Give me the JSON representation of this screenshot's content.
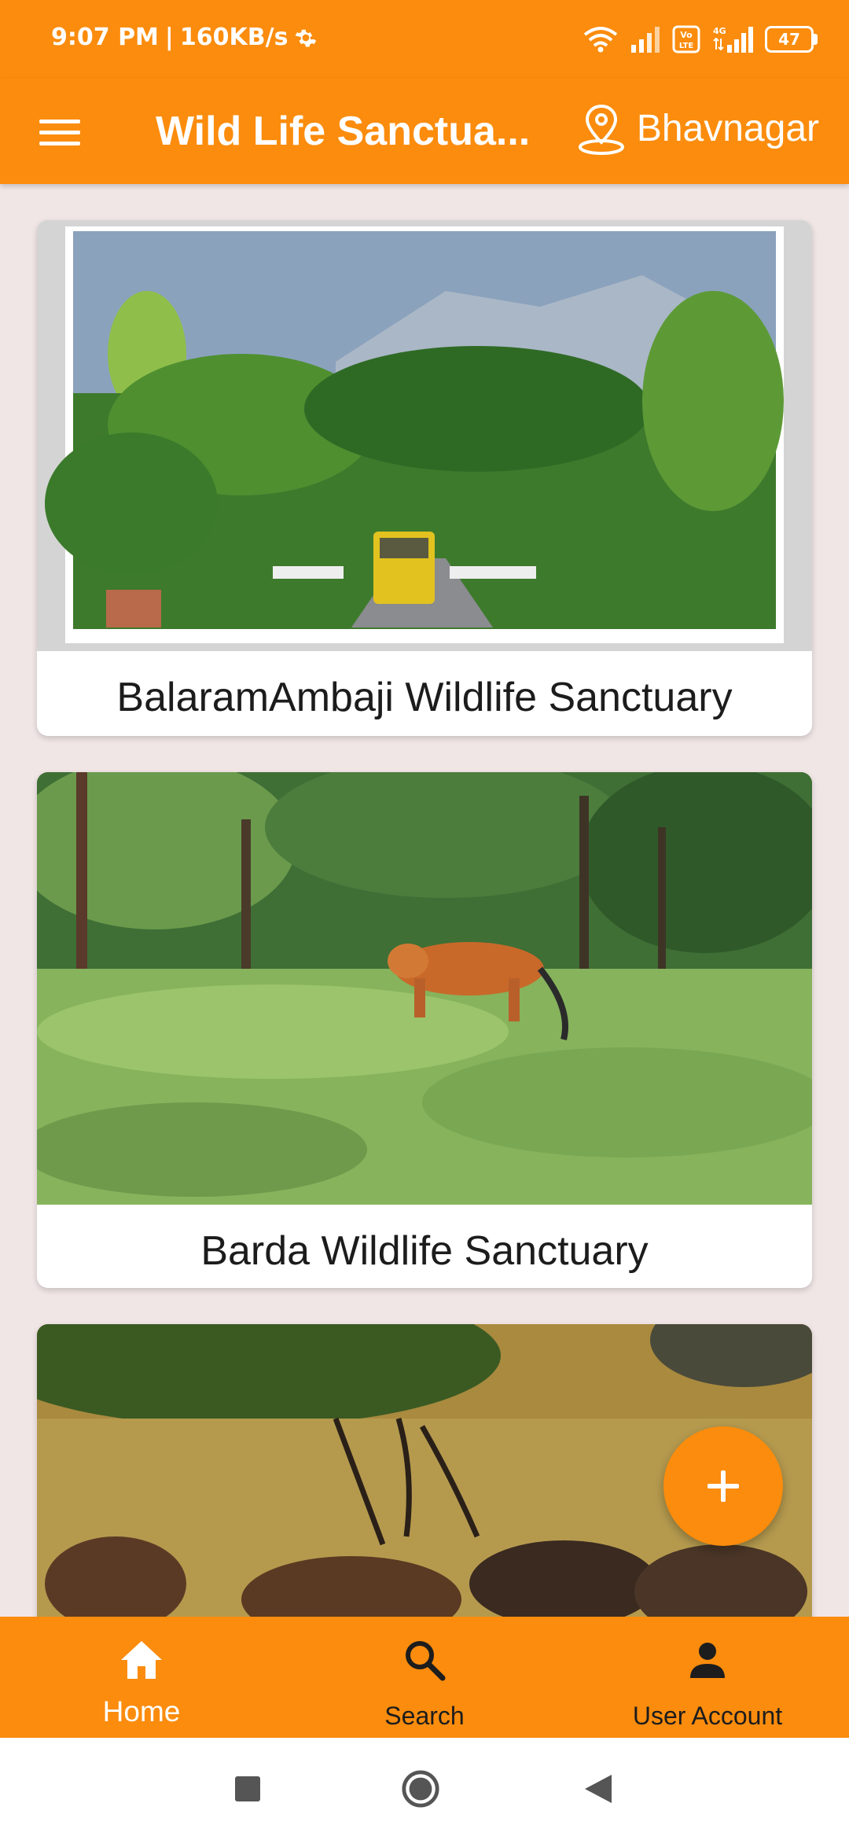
{
  "status_bar": {
    "time": "9:07 PM",
    "speed": "160KB/s",
    "battery": "47",
    "icons": [
      "settings-icon",
      "wifi-icon",
      "signal-icon",
      "volte-icon",
      "4g-signal-icon",
      "battery-icon"
    ]
  },
  "app_bar": {
    "title": "Wild Life Sanctua...",
    "location": "Bhavnagar",
    "menu_icon": "menu-icon",
    "location_icon": "location-pin-icon"
  },
  "cards": [
    {
      "title": "BalaramAmbaji Wildlife Sanctuary",
      "image": "road-through-forest-with-mountains"
    },
    {
      "title": "Barda Wildlife Sanctuary",
      "image": "tiger-in-grassland"
    },
    {
      "title": "",
      "image": "blackbuck-antelopes"
    }
  ],
  "fab": {
    "icon": "plus-icon"
  },
  "bottom_nav": {
    "items": [
      {
        "label": "Home",
        "icon": "home-icon",
        "active": true
      },
      {
        "label": "Search",
        "icon": "search-icon",
        "active": false
      },
      {
        "label": "User Account",
        "icon": "person-icon",
        "active": false
      }
    ]
  },
  "colors": {
    "primary": "#fb8c0d",
    "background": "#f1e6e6",
    "card": "#ffffff"
  }
}
